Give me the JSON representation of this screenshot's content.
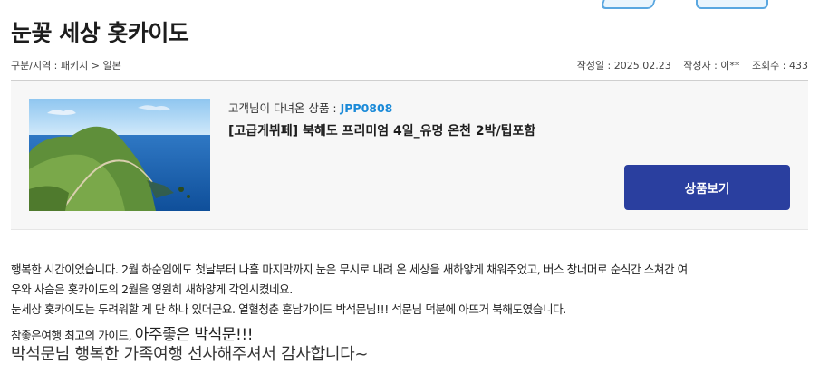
{
  "post": {
    "title": "눈꽃 세상 홋카이도",
    "category": "구분/지역 : 패키지 > 일본",
    "date": "작성일 : 2025.02.23",
    "author": "작성자 : 이**",
    "views": "조회수 : 433"
  },
  "product": {
    "code_label": "고객님이 다녀온 상품 : ",
    "code": "JPP0808",
    "name": "[고급게뷔페] 북해도 프리미엄 4일_유명 온천 2박/팁포함",
    "button_label": "상품보기",
    "image_alt": "coastal cliff landscape"
  },
  "body": {
    "line1": "행복한 시간이었습니다.  2월 하순임에도 첫날부터 나흘 마지막까지 눈은 무시로 내려 온 세상을 새하얗게 채워주었고, 버스 창너머로 순식간 스쳐간 여",
    "line2": "우와 사슴은 홋카이도의 2월을 영원히 새하얗게 각인시켰네요.",
    "line3": "눈세상 홋카이도는 두려워할 게 단 하나 있더군요. 열혈청춘 훈남가이드 박석문님!!!  석문님 덕분에 아뜨거 북해도였습니다.",
    "line4_prefix": "참좋은여행 최고의 가이드, ",
    "line4_big": "아주좋은 박석문!!!",
    "line5": "박석문님 행복한 가족여행 선사해주셔서 감사합니다~"
  }
}
